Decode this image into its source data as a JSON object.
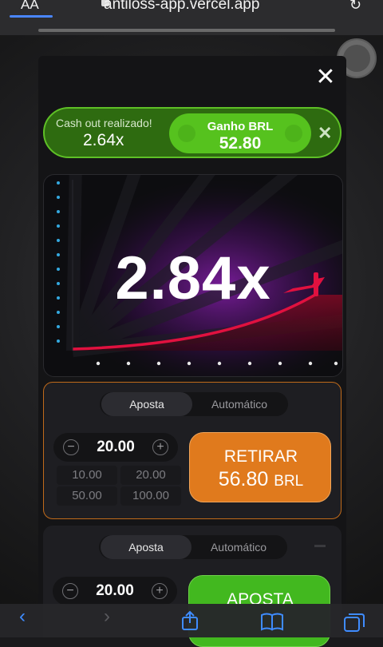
{
  "browser": {
    "aa_label": "AA",
    "url": "antiloss-app.vercel.app",
    "reload_glyph": "C"
  },
  "modal": {
    "close_glyph": "✕"
  },
  "toast": {
    "subtitle": "Cash out realizado!",
    "multiplier": "2.64x",
    "win_label": "Ganho BRL",
    "win_value": "52.80",
    "close_glyph": "✕",
    "accent": "#5ec026"
  },
  "game": {
    "multiplier": "2.84x",
    "accent": "#e0113f"
  },
  "bet1": {
    "tabs": [
      "Aposta",
      "Automático"
    ],
    "amount": "20.00",
    "quick": [
      "10.00",
      "20.00",
      "50.00",
      "100.00"
    ],
    "action_label": "RETIRAR",
    "action_amount": "56.80",
    "action_currency": "BRL",
    "accent": "#e07a1d"
  },
  "bet2": {
    "tabs": [
      "Aposta",
      "Automático"
    ],
    "amount": "20.00",
    "action_label": "APOSTA",
    "accent": "#42b81f"
  },
  "toolbar": {
    "icons": [
      "back-icon",
      "forward-icon",
      "share-icon",
      "bookmarks-icon",
      "tabs-icon"
    ]
  }
}
